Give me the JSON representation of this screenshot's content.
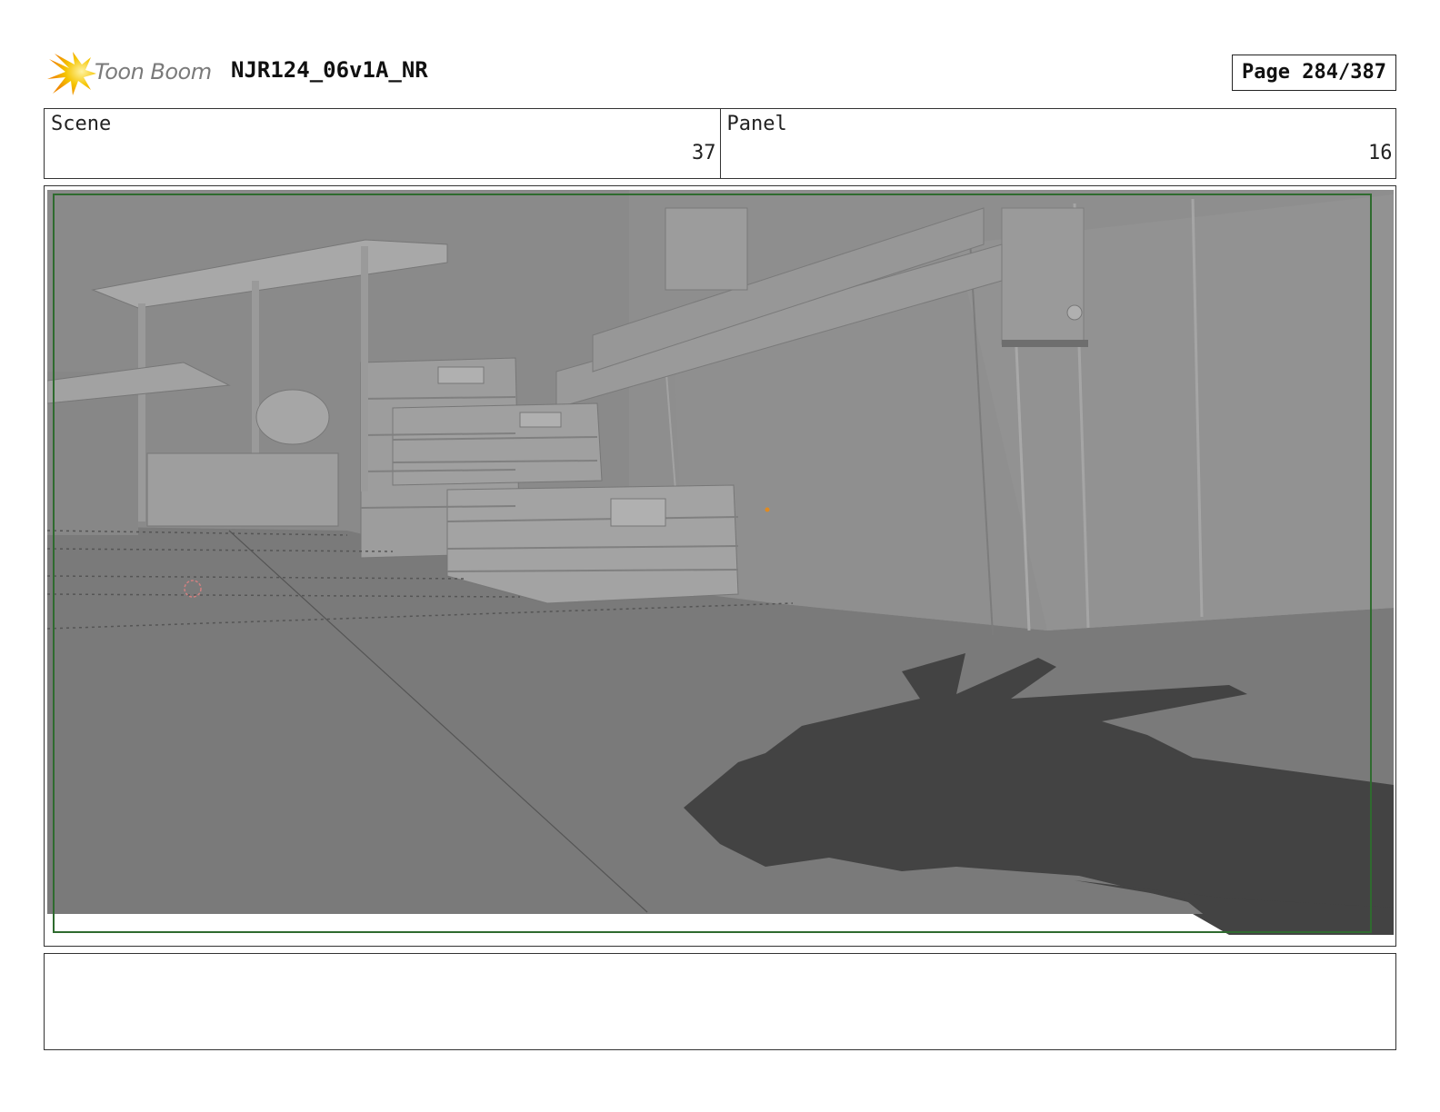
{
  "header": {
    "brand": "Toon Boom",
    "logo_icon": "starburst-logo-icon",
    "document_title": "NJR124_06v1A_NR",
    "page_label": "Page 284/387"
  },
  "info": {
    "scene_label": "Scene",
    "scene_value": "37",
    "panel_label": "Panel",
    "panel_value": "16"
  },
  "frame": {
    "image": "3d-render-of-dock-with-crates-and-creature-shadow",
    "safe_frame_color": "#2f6b2f"
  },
  "caption": {
    "text": ""
  },
  "colors": {
    "logo_yellow": "#f5c400",
    "logo_orange": "#f08a00",
    "border": "#333333"
  }
}
